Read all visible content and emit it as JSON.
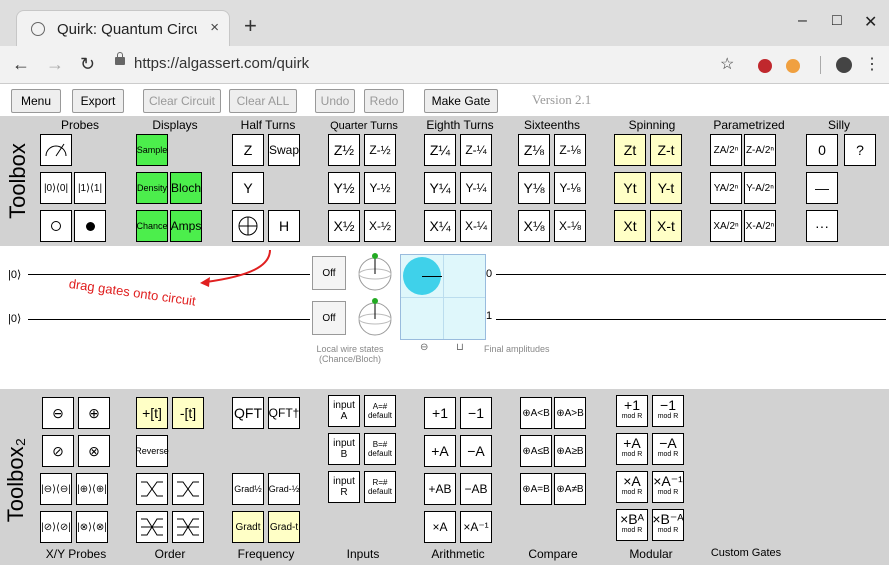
{
  "browser": {
    "tab_title": "Quirk: Quantum Circuit",
    "tab_close": "×",
    "new_tab": "+",
    "url": "https://algassert.com/quirk",
    "win_min": "‒",
    "win_max": "□",
    "win_close": "✕"
  },
  "appbar": {
    "menu": "Menu",
    "export": "Export",
    "clear_circuit": "Clear Circuit",
    "clear_all": "Clear ALL",
    "undo": "Undo",
    "redo": "Redo",
    "make_gate": "Make Gate",
    "version": "Version 2.1"
  },
  "toolbox1": {
    "title": "Toolbox",
    "groups": {
      "probes": "Probes",
      "displays": "Displays",
      "half": "Half Turns",
      "quarter": "Quarter Turns",
      "eighth": "Eighth Turns",
      "sixteenths": "Sixteenths",
      "spinning": "Spinning",
      "param": "Parametrized",
      "silly": "Silly"
    },
    "gates": {
      "probe_pair1": "|0⟩⟨0|",
      "probe_pair2": "|1⟩⟨1|",
      "sample": "Sample",
      "density": "Density",
      "bloch": "Bloch",
      "chance": "Chance",
      "amps": "Amps",
      "z": "Z",
      "swap": "Swap",
      "y": "Y",
      "h": "H",
      "z_half": "Z½",
      "z_mhalf": "Z-½",
      "y_half": "Y½",
      "y_mhalf": "Y-½",
      "x_half": "X½",
      "x_mhalf": "X-½",
      "z_q": "Z¼",
      "z_mq": "Z-¼",
      "y_q": "Y¼",
      "y_mq": "Y-¼",
      "x_q": "X¼",
      "x_mq": "X-¼",
      "z_e": "Z⅛",
      "z_me": "Z-⅛",
      "y_e": "Y⅛",
      "y_me": "Y-⅛",
      "x_e": "X⅛",
      "x_me": "X-⅛",
      "zt": "Zt",
      "zmt": "Z-t",
      "yt": "Yt",
      "ymt": "Y-t",
      "xt": "Xt",
      "xmt": "X-t",
      "z_a": "ZA/2ⁿ",
      "z_ma": "Z-A/2ⁿ",
      "y_a": "YA/2ⁿ",
      "y_ma": "Y-A/2ⁿ",
      "x_a": "XA/2ⁿ",
      "x_ma": "X-A/2ⁿ",
      "zero": "0",
      "question": "?",
      "dash": "—",
      "ellipsis": "···"
    }
  },
  "circuit": {
    "wire0_label": "|0⟩",
    "wire1_label": "|0⟩",
    "hint": "drag gates onto circuit",
    "off": "Off",
    "local_states": "Local wire states",
    "chance_bloch": "(Chance/Bloch)",
    "final_amps": "Final amplitudes",
    "amp0": "0",
    "amp1": "1"
  },
  "toolbox2": {
    "title": "Toolbox₂",
    "groups": {
      "xy": "X/Y Probes",
      "order": "Order",
      "frequency": "Frequency",
      "inputs": "Inputs",
      "arith": "Arithmetic",
      "compare": "Compare",
      "modular": "Modular",
      "custom": "Custom Gates"
    },
    "gates": {
      "minus_circ": "⊖",
      "plus_circ": "⊕",
      "slash_circ": "⊘",
      "times_circ": "⊗",
      "xy1": "|⊖⟩⟨⊖|",
      "xy2": "|⊕⟩⟨⊕|",
      "xy3": "|⊘⟩⟨⊘|",
      "xy4": "|⊗⟩⟨⊗|",
      "plus_t": "+[t]",
      "minus_t": "-[t]",
      "reverse": "Reverse",
      "qft": "QFT",
      "qft_dag": "QFT†",
      "grad_half": "Grad½",
      "grad_mhalf": "Grad-½",
      "grad_t": "Gradt",
      "grad_mt": "Grad-t",
      "input_a": "input A",
      "a_def": "A=# default",
      "input_b": "input B",
      "b_def": "B=# default",
      "input_r": "input R",
      "r_def": "R=# default",
      "p1": "+1",
      "m1": "−1",
      "pa": "+A",
      "ma": "−A",
      "pab": "+AB",
      "mab": "−AB",
      "xa": "×A",
      "xainv": "×A⁻¹",
      "c1": "⊕A<B",
      "c2": "⊕A>B",
      "c3": "⊕A≤B",
      "c4": "⊕A≥B",
      "c5": "⊕A=B",
      "c6": "⊕A≠B",
      "m_p1": "+1",
      "m_m1": "−1",
      "m_pa": "+A",
      "m_ma": "−A",
      "m_xa": "×A",
      "m_xainv": "×A⁻¹",
      "m_xba": "×Bᴬ",
      "m_xbma": "×B⁻ᴬ",
      "modr": "mod R"
    }
  }
}
